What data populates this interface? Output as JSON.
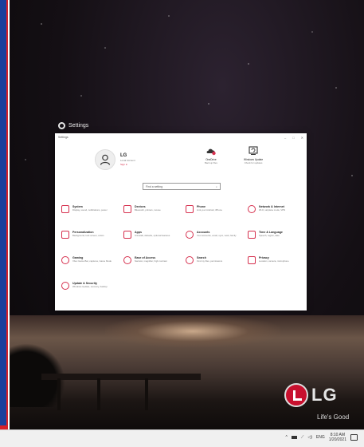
{
  "desktop": {
    "settings_caption": "Settings",
    "brand": "LG",
    "brand_tagline": "Life's Good"
  },
  "window": {
    "title": "Settings",
    "controls": [
      "–",
      "□",
      "✕"
    ],
    "profile": {
      "name": "LG",
      "account_type": "Local Account",
      "link": "Sign in"
    },
    "status": [
      {
        "title": "OneDrive",
        "subtitle": "Back up files",
        "icon": "onedrive-icon"
      },
      {
        "title": "Windows Update",
        "subtitle": "Check for updates",
        "icon": "windows-update-icon"
      }
    ],
    "search_placeholder": "Find a setting",
    "categories": [
      {
        "label": "System",
        "desc": "Display, sound, notifications, power",
        "icon": "system-icon"
      },
      {
        "label": "Devices",
        "desc": "Bluetooth, printers, mouse",
        "icon": "devices-icon"
      },
      {
        "label": "Phone",
        "desc": "Link your Android, iPhone",
        "icon": "phone-icon"
      },
      {
        "label": "Network & Internet",
        "desc": "Wi-Fi, airplane mode, VPN",
        "icon": "network-icon"
      },
      {
        "label": "Personalization",
        "desc": "Background, lock screen, colors",
        "icon": "personalization-icon"
      },
      {
        "label": "Apps",
        "desc": "Uninstall, defaults, optional features",
        "icon": "apps-icon"
      },
      {
        "label": "Accounts",
        "desc": "Your accounts, email, sync, work, family",
        "icon": "accounts-icon"
      },
      {
        "label": "Time & Language",
        "desc": "Speech, region, date",
        "icon": "time-language-icon"
      },
      {
        "label": "Gaming",
        "desc": "Xbox Game Bar, captures, Game Mode",
        "icon": "gaming-icon"
      },
      {
        "label": "Ease of Access",
        "desc": "Narrator, magnifier, high contrast",
        "icon": "ease-of-access-icon"
      },
      {
        "label": "Search",
        "desc": "Find my files, permissions",
        "icon": "search-icon"
      },
      {
        "label": "Privacy",
        "desc": "Location, camera, microphone",
        "icon": "privacy-icon"
      },
      {
        "label": "Update & Security",
        "desc": "Windows Update, recovery, backup",
        "icon": "update-security-icon"
      }
    ]
  },
  "taskbar": {
    "language": "ENG",
    "time": "8:10 AM",
    "date": "1/20/2021"
  },
  "colors": {
    "accent": "#d6304e",
    "lg_red": "#c8102e",
    "left_bar": "#1b3f9c"
  }
}
